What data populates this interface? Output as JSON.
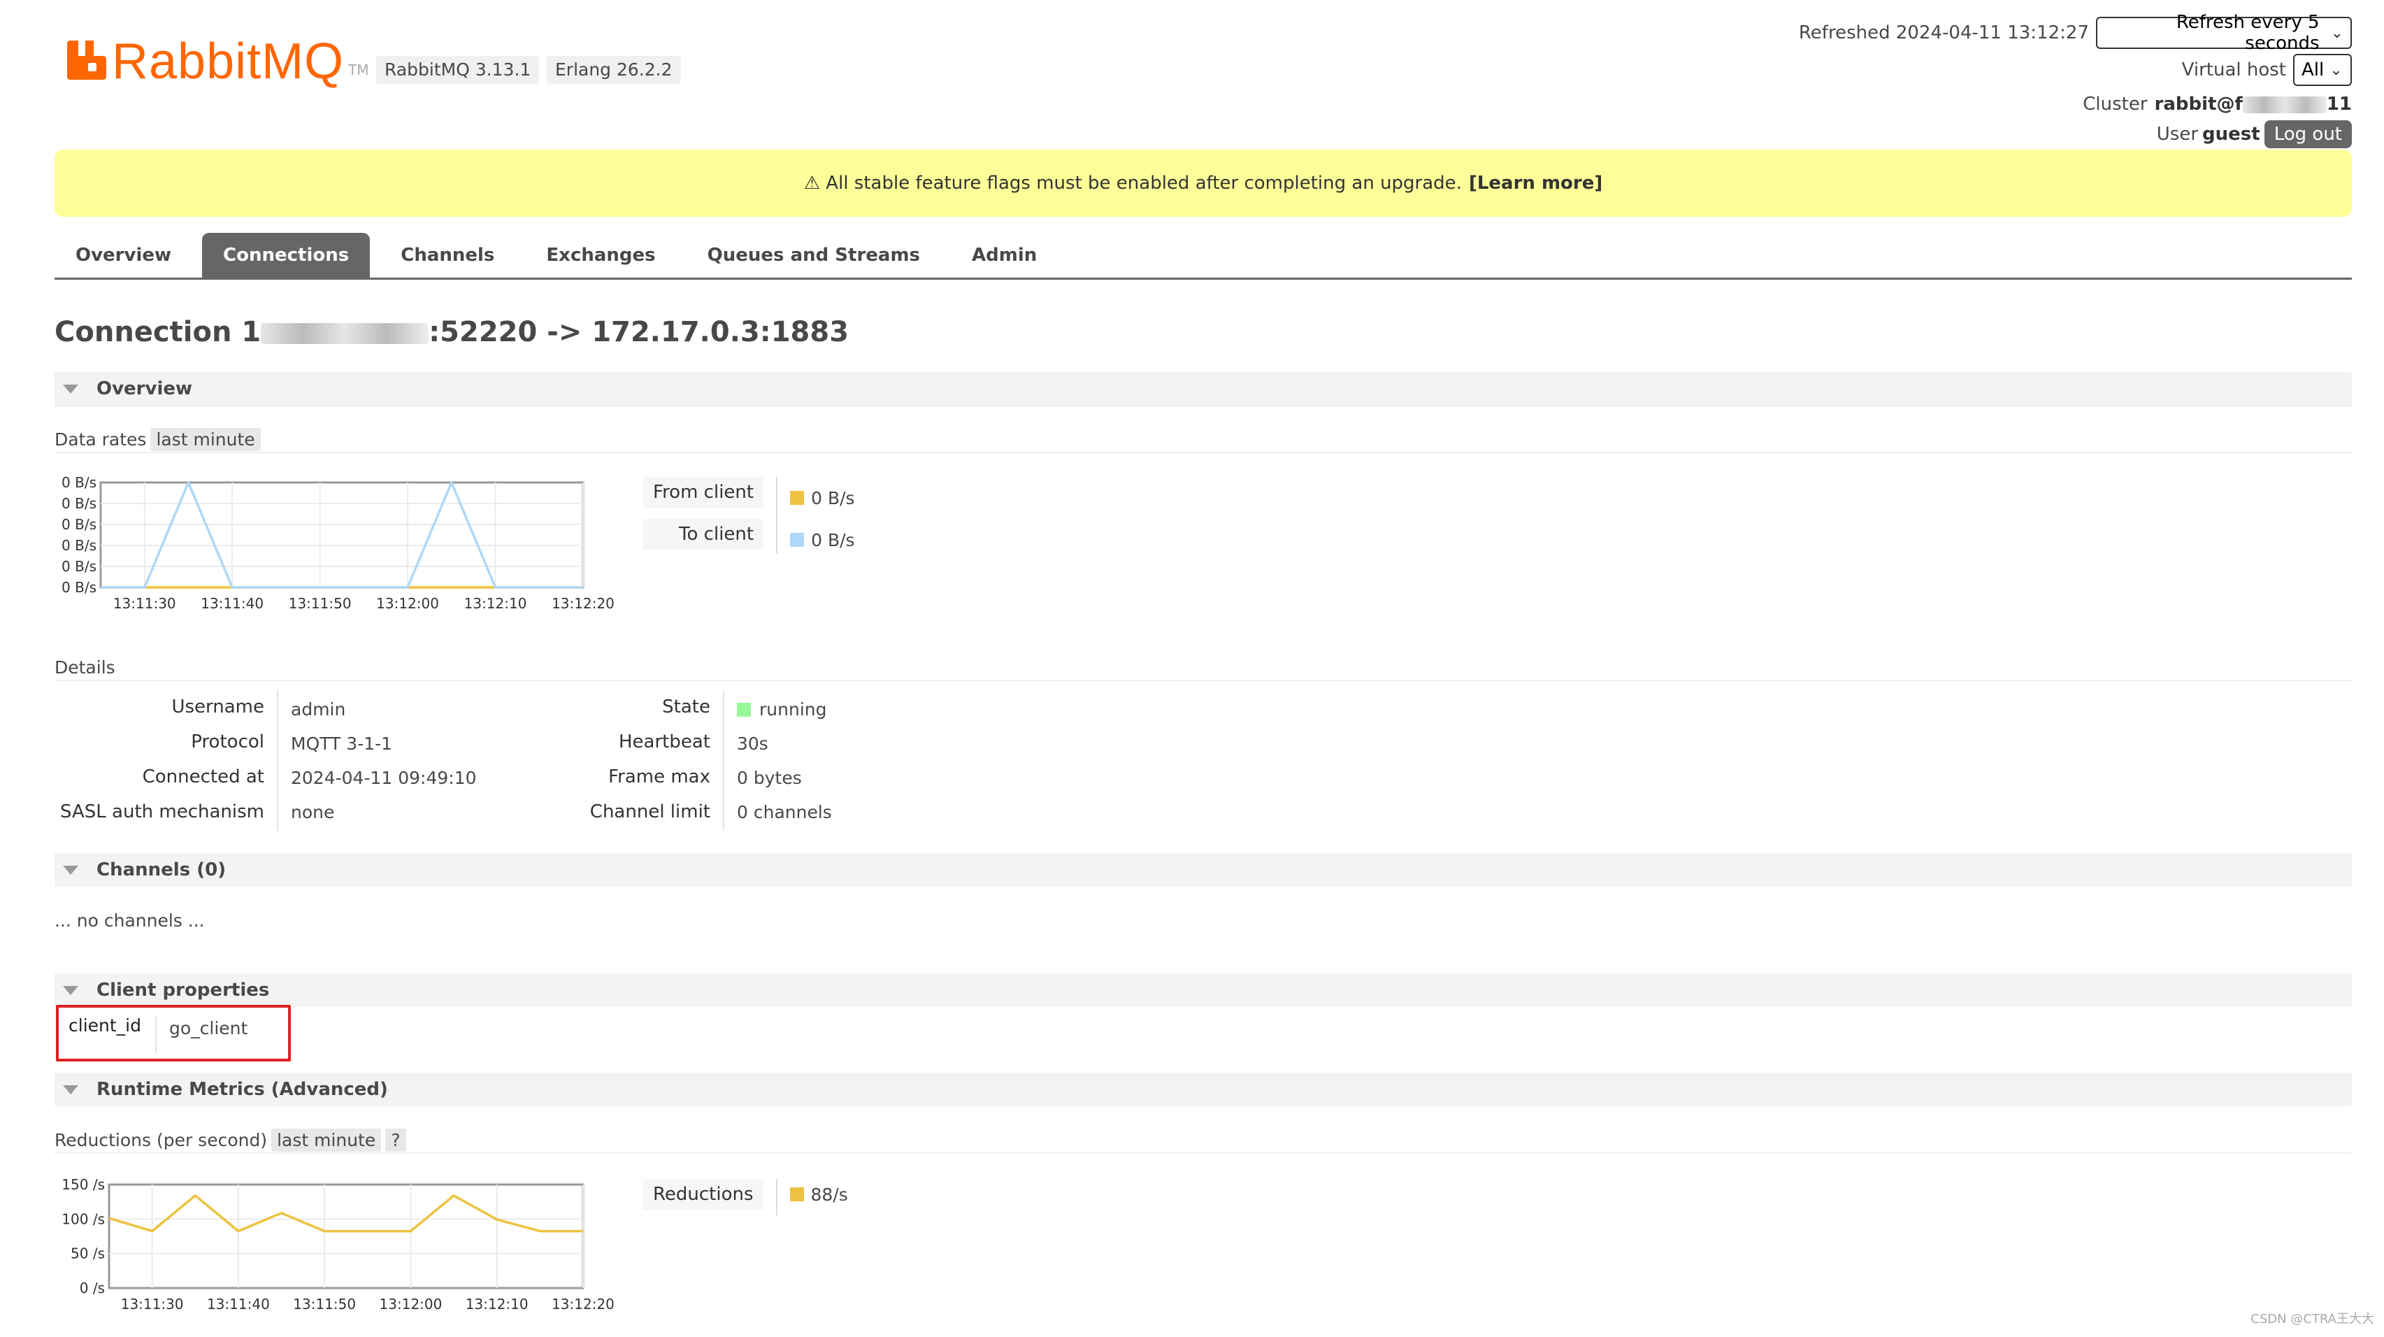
{
  "app": {
    "logo_text": "RabbitMQ",
    "logo_tm": "TM",
    "version": "RabbitMQ 3.13.1",
    "erlang": "Erlang 26.2.2",
    "brand_color": "#ff6600"
  },
  "header": {
    "refreshed_label": "Refreshed 2024-04-11 13:12:27",
    "refresh_select": "Refresh every 5 seconds",
    "vhost_label": "Virtual host",
    "vhost_select": "All",
    "cluster_label": "Cluster",
    "cluster_name_start": "rabbit@f",
    "cluster_name_end": "11",
    "user_label": "User",
    "user_name": "guest",
    "logout": "Log out"
  },
  "banner": {
    "icon": "warning-icon",
    "text": "⚠ All stable feature flags must be enabled after completing an upgrade.",
    "link": "[Learn more]"
  },
  "tabs": [
    {
      "label": "Overview",
      "active": false
    },
    {
      "label": "Connections",
      "active": true
    },
    {
      "label": "Channels",
      "active": false
    },
    {
      "label": "Exchanges",
      "active": false
    },
    {
      "label": "Queues and Streams",
      "active": false
    },
    {
      "label": "Admin",
      "active": false
    }
  ],
  "title": {
    "prefix": "Connection 1",
    "suffix": ":52220 -> 172.17.0.3:1883"
  },
  "overview": {
    "header": "Overview",
    "data_rates_label": "Data rates",
    "range": "last minute",
    "legend": [
      {
        "label": "From client",
        "value": "0 B/s",
        "color": "#edc240"
      },
      {
        "label": "To client",
        "value": "0 B/s",
        "color": "#afd8f8"
      }
    ]
  },
  "details": {
    "header": "Details",
    "left": [
      {
        "k": "Username",
        "v": "admin"
      },
      {
        "k": "Protocol",
        "v": "MQTT 3-1-1"
      },
      {
        "k": "Connected at",
        "v": "2024-04-11 09:49:10"
      },
      {
        "k": "SASL auth mechanism",
        "v": "none"
      }
    ],
    "right": [
      {
        "k": "State",
        "v": "running"
      },
      {
        "k": "Heartbeat",
        "v": "30s"
      },
      {
        "k": "Frame max",
        "v": "0 bytes"
      },
      {
        "k": "Channel limit",
        "v": "0 channels"
      }
    ],
    "state_color": "#98f898"
  },
  "channels": {
    "header": "Channels (0)",
    "empty": "... no channels ..."
  },
  "client_properties": {
    "header": "Client properties",
    "key": "client_id",
    "value": "go_client"
  },
  "runtime": {
    "header": "Runtime Metrics (Advanced)",
    "reductions_label": "Reductions (per second)",
    "range": "last minute",
    "help": "?",
    "legend": {
      "label": "Reductions",
      "value": "88/s",
      "color": "#edc240"
    }
  },
  "chart_data": [
    {
      "type": "line",
      "title": "",
      "xlabel": "",
      "ylabel": "",
      "x": [
        "13:11:25",
        "13:11:30",
        "13:11:35",
        "13:11:40",
        "13:11:45",
        "13:11:50",
        "13:11:55",
        "13:12:00",
        "13:12:05",
        "13:12:10",
        "13:12:15",
        "13:12:20"
      ],
      "x_ticks": [
        "13:11:30",
        "13:11:40",
        "13:11:50",
        "13:12:00",
        "13:12:10",
        "13:12:20"
      ],
      "y_ticks": [
        "0 B/s",
        "0 B/s",
        "0 B/s",
        "0 B/s",
        "0 B/s",
        "0 B/s"
      ],
      "ylim": [
        0,
        1
      ],
      "grid": true,
      "series": [
        {
          "name": "From client",
          "color": "#edc240",
          "values": [
            0,
            0,
            0,
            0,
            0,
            0,
            0,
            0,
            0,
            0,
            0,
            0
          ]
        },
        {
          "name": "To client",
          "color": "#afd8f8",
          "values": [
            0,
            0,
            1,
            0,
            0,
            0,
            0,
            0,
            1,
            0,
            0,
            0
          ]
        }
      ]
    },
    {
      "type": "line",
      "title": "",
      "xlabel": "",
      "ylabel": "",
      "x": [
        "13:11:25",
        "13:11:30",
        "13:11:35",
        "13:11:40",
        "13:11:45",
        "13:11:50",
        "13:11:55",
        "13:12:00",
        "13:12:05",
        "13:12:10",
        "13:12:15",
        "13:12:20"
      ],
      "x_ticks": [
        "13:11:30",
        "13:11:40",
        "13:11:50",
        "13:12:00",
        "13:12:10",
        "13:12:20"
      ],
      "y_ticks": [
        "150 /s",
        "100 /s",
        "50 /s",
        "0 /s"
      ],
      "ylim": [
        0,
        160
      ],
      "grid": true,
      "series": [
        {
          "name": "Reductions",
          "color": "#edc240",
          "values": [
            108,
            88,
            143,
            88,
            116,
            88,
            88,
            88,
            143,
            106,
            88,
            88
          ]
        }
      ]
    }
  ],
  "watermark": "CSDN @CTRA王大大"
}
